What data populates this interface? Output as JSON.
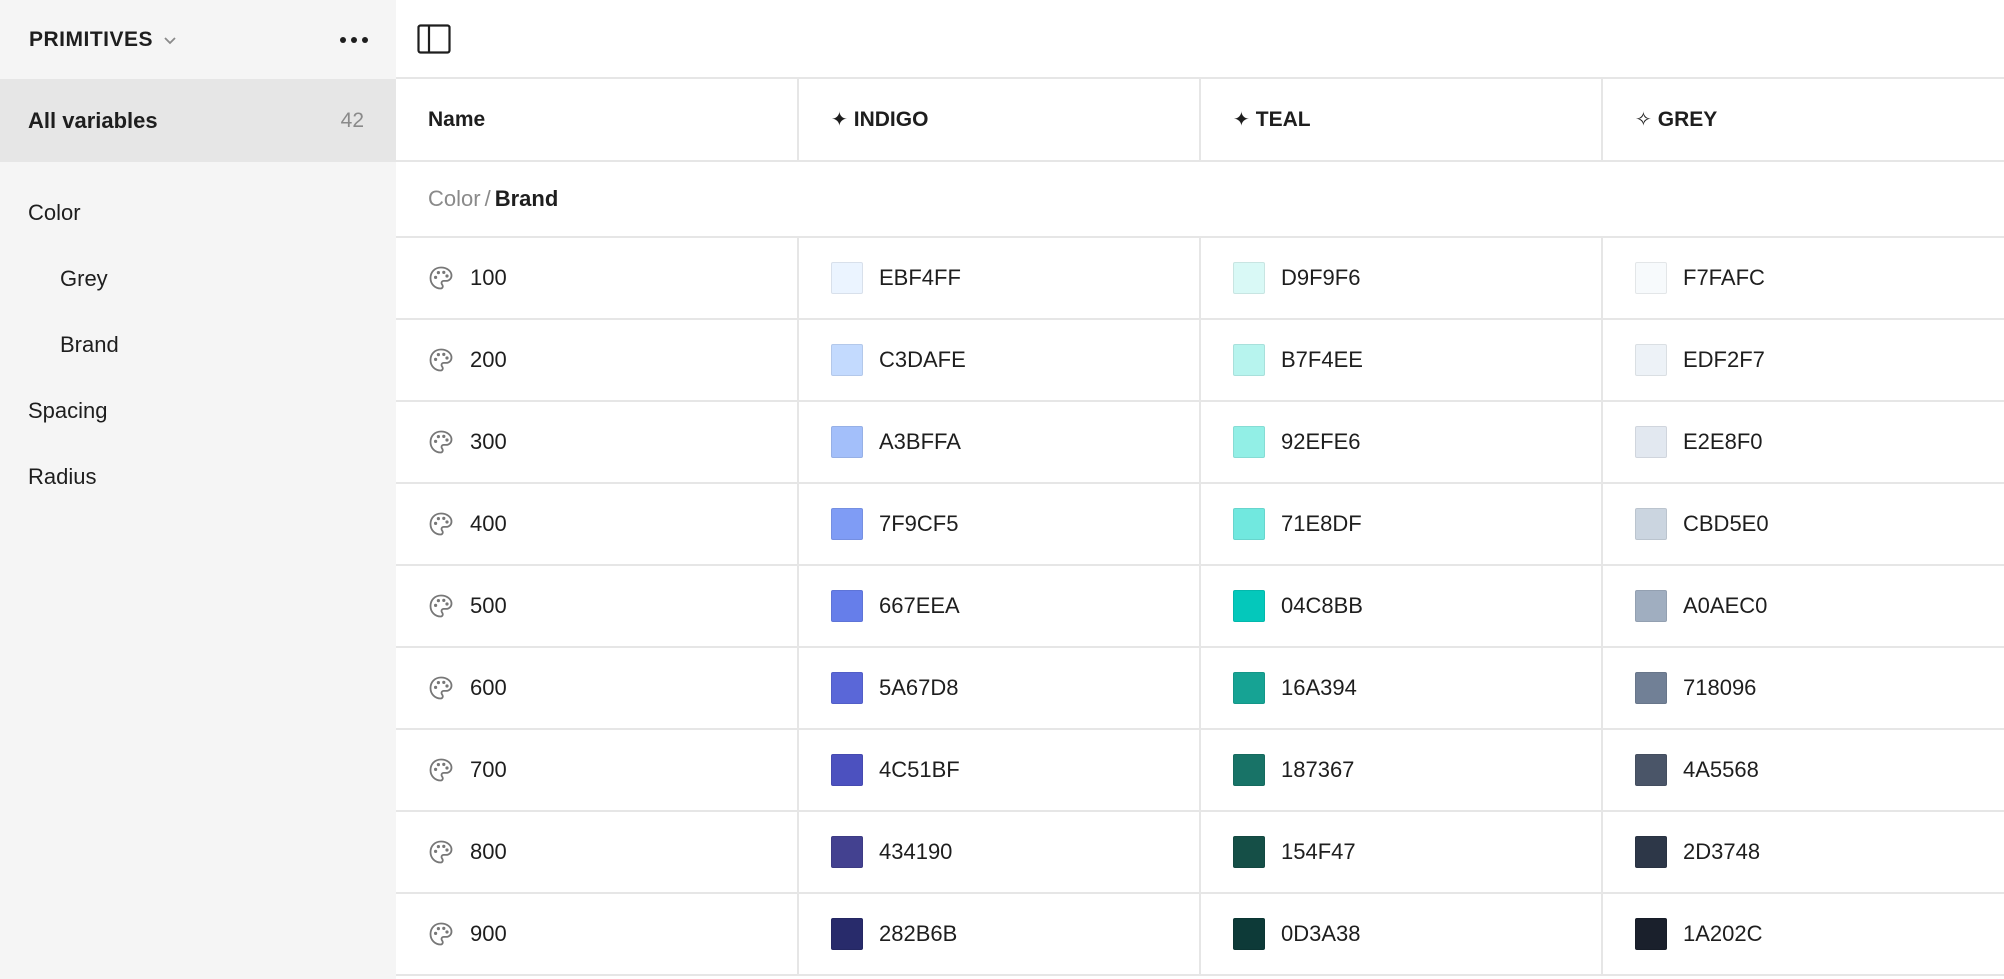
{
  "sidebar": {
    "collection_title": "PRIMITIVES",
    "all_variables_label": "All variables",
    "all_variables_count": "42",
    "groups": [
      {
        "label": "Color",
        "level": 0
      },
      {
        "label": "Grey",
        "level": 1
      },
      {
        "label": "Brand",
        "level": 1
      },
      {
        "label": "Spacing",
        "level": 0
      },
      {
        "label": "Radius",
        "level": 0
      }
    ]
  },
  "table": {
    "headers": {
      "name": "Name",
      "modes": [
        {
          "label": "INDIGO",
          "icon": "sparkle-filled-icon",
          "glyph": "✦"
        },
        {
          "label": "TEAL",
          "icon": "sparkle-filled-icon",
          "glyph": "✦"
        },
        {
          "label": "GREY",
          "icon": "sparkle-outline-icon",
          "glyph": "✧"
        }
      ]
    },
    "group_path": {
      "parent": "Color",
      "separator": "/",
      "leaf": "Brand"
    },
    "rows": [
      {
        "name": "100",
        "values": [
          "EBF4FF",
          "D9F9F6",
          "F7FAFC"
        ]
      },
      {
        "name": "200",
        "values": [
          "C3DAFE",
          "B7F4EE",
          "EDF2F7"
        ]
      },
      {
        "name": "300",
        "values": [
          "A3BFFA",
          "92EFE6",
          "E2E8F0"
        ]
      },
      {
        "name": "400",
        "values": [
          "7F9CF5",
          "71E8DF",
          "CBD5E0"
        ]
      },
      {
        "name": "500",
        "values": [
          "667EEA",
          "04C8BB",
          "A0AEC0"
        ]
      },
      {
        "name": "600",
        "values": [
          "5A67D8",
          "16A394",
          "718096"
        ]
      },
      {
        "name": "700",
        "values": [
          "4C51BF",
          "187367",
          "4A5568"
        ]
      },
      {
        "name": "800",
        "values": [
          "434190",
          "154F47",
          "2D3748"
        ]
      },
      {
        "name": "900",
        "values": [
          "282B6B",
          "0D3A38",
          "1A202C"
        ]
      }
    ]
  }
}
